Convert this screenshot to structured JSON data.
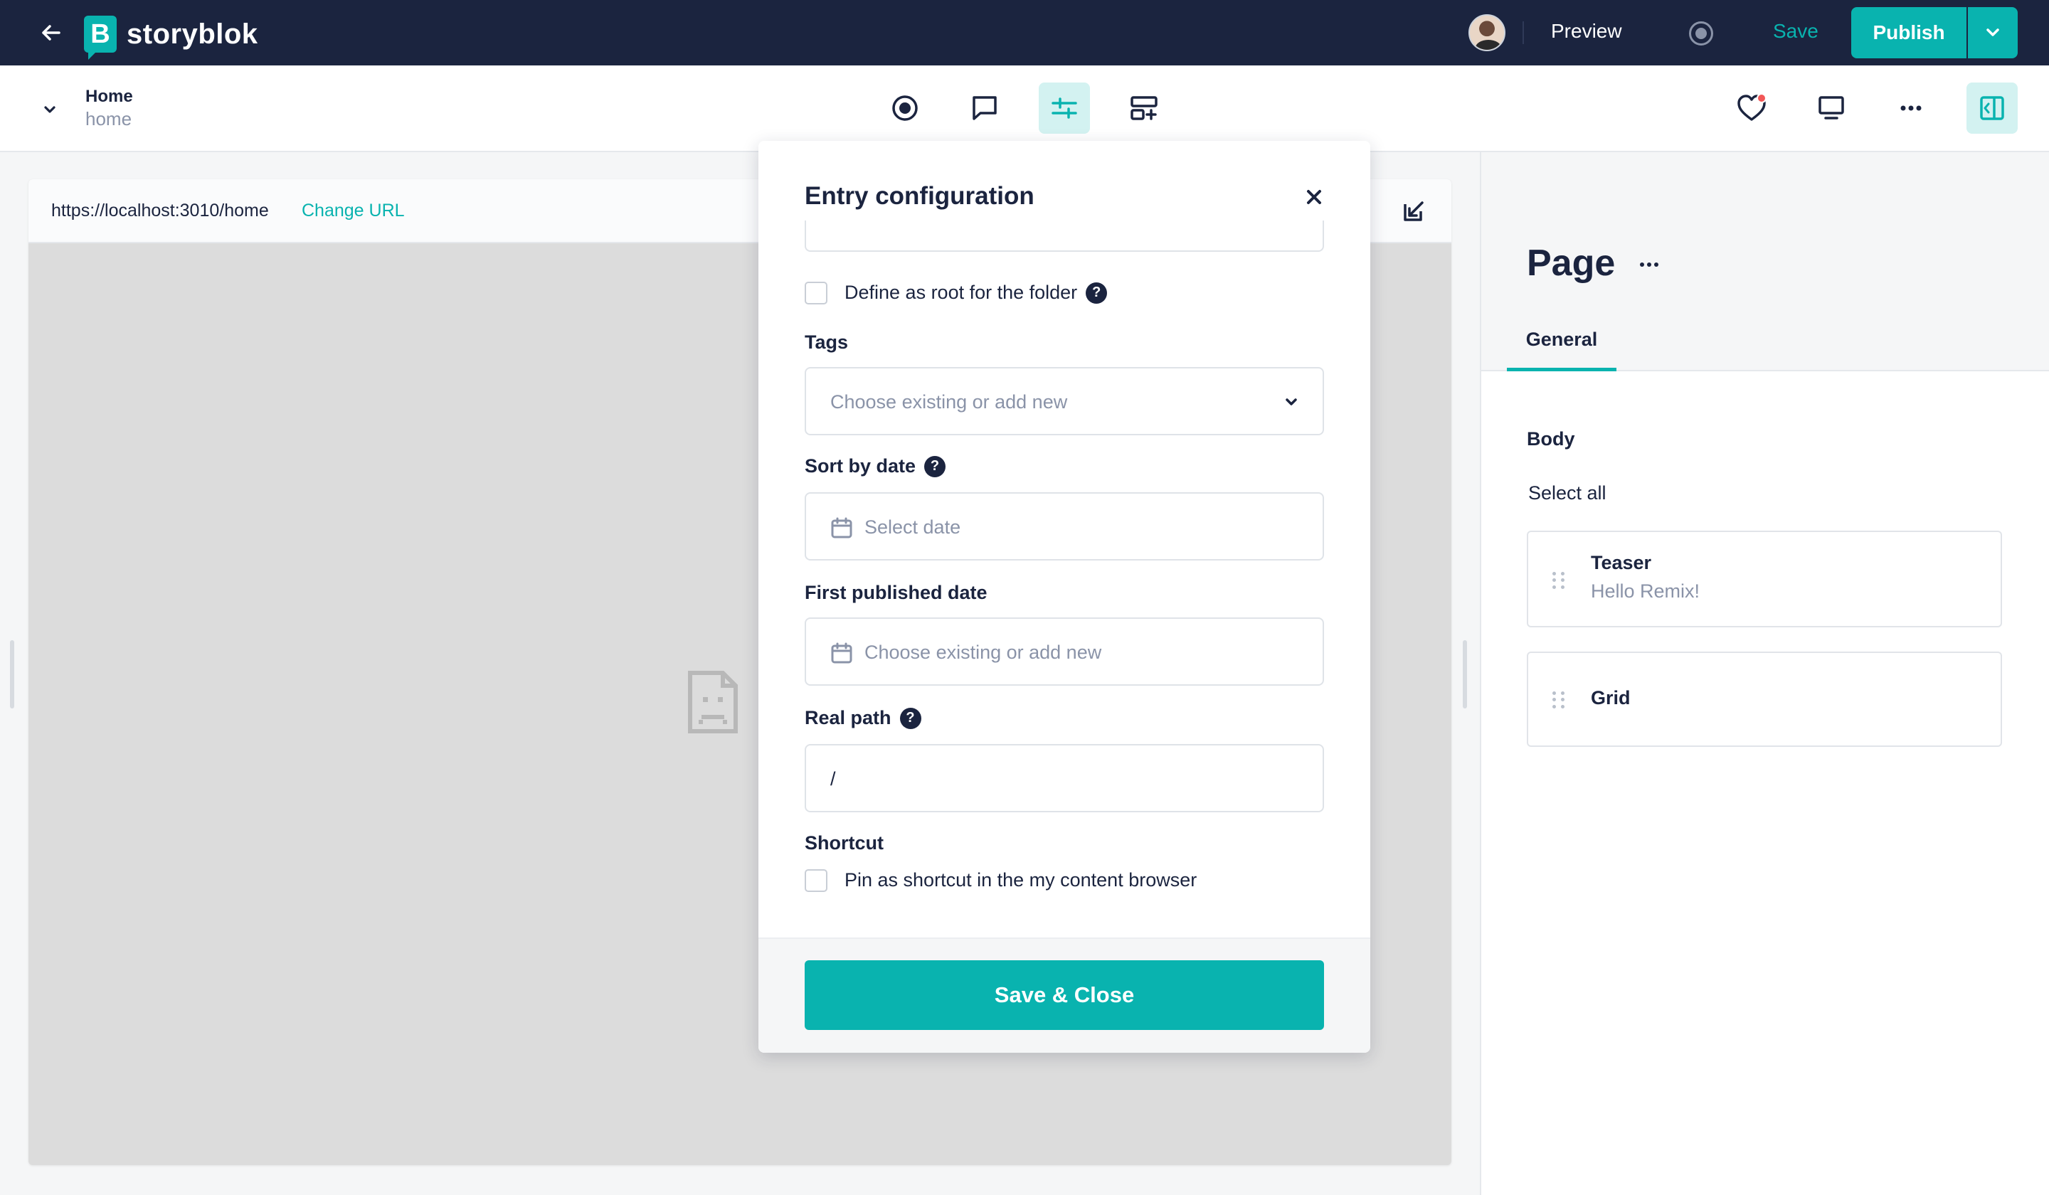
{
  "topbar": {
    "logo_letter": "B",
    "app_name": "storyblok",
    "preview_label": "Preview",
    "save_label": "Save",
    "publish_label": "Publish"
  },
  "story": {
    "title": "Home",
    "slug": "home"
  },
  "preview": {
    "url": "https://localhost:3010/home",
    "change_url_label": "Change URL"
  },
  "modal": {
    "title": "Entry configuration",
    "root_folder_label": "Define as root for the folder",
    "tags_label": "Tags",
    "tags_placeholder": "Choose existing or add new",
    "sort_by_date_label": "Sort by date",
    "sort_by_date_placeholder": "Select date",
    "first_published_label": "First published date",
    "first_published_placeholder": "Choose existing or add new",
    "real_path_label": "Real path",
    "real_path_value": "/",
    "shortcut_label": "Shortcut",
    "shortcut_option": "Pin as shortcut in the my content browser",
    "save_close_label": "Save & Close"
  },
  "panel": {
    "title": "Page",
    "tab_general": "General",
    "body_label": "Body",
    "select_all": "Select all",
    "blocks": [
      {
        "name": "Teaser",
        "subtitle": "Hello Remix!"
      },
      {
        "name": "Grid",
        "subtitle": ""
      }
    ]
  },
  "colors": {
    "accent": "#09b3af",
    "navy": "#1b243f",
    "muted": "#8a93a8",
    "notification": "#f25757"
  },
  "icons": {
    "back": "arrow-left-icon",
    "visual_editor": "target-icon",
    "comments": "comment-icon",
    "config": "sliders-icon",
    "blocks": "add-block-icon",
    "favorite": "heart-icon",
    "device": "monitor-icon",
    "more": "more-horizontal-icon",
    "sidebar": "sidebar-toggle-icon"
  }
}
